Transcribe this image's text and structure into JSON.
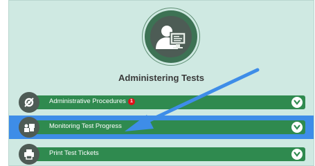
{
  "header": {
    "title": "Administering Tests",
    "icon": "teacher-computer-icon"
  },
  "items": [
    {
      "label": "Administrative Procedures",
      "icon": "gear-icon",
      "badge": "1"
    },
    {
      "label": "Monitoring Test Progress",
      "icon": "presenter-icon",
      "highlighted": true
    },
    {
      "label": "Print Test Tickets",
      "icon": "printer-icon"
    }
  ],
  "colors": {
    "card_bg": "#cfe9e2",
    "bar_green": "#2f8a4f",
    "icon_dark": "#4e5b55",
    "highlight_blue": "#3e8de8",
    "badge_red": "#e0111a"
  }
}
